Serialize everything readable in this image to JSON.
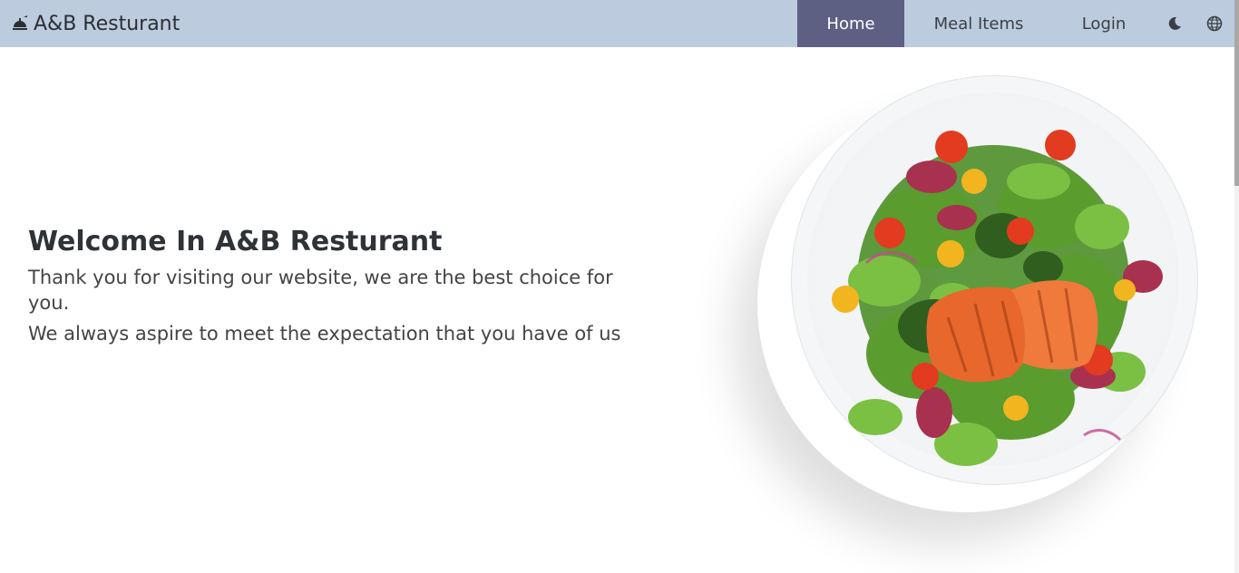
{
  "navbar": {
    "brand": "A&B Resturant",
    "links": {
      "home": "Home",
      "meals": "Meal Items",
      "login": "Login"
    },
    "icons": {
      "brand": "cloche-icon",
      "theme": "moon-icon",
      "language": "globe-icon"
    },
    "colors": {
      "background": "#bccbde",
      "active": "#5d5f83"
    }
  },
  "hero": {
    "title": "Welcome In A&B Resturant",
    "paragraph1": "Thank you for visiting our website, we are the best choice for you.",
    "paragraph2": "We always aspire to meet the expectation that you have of us"
  }
}
